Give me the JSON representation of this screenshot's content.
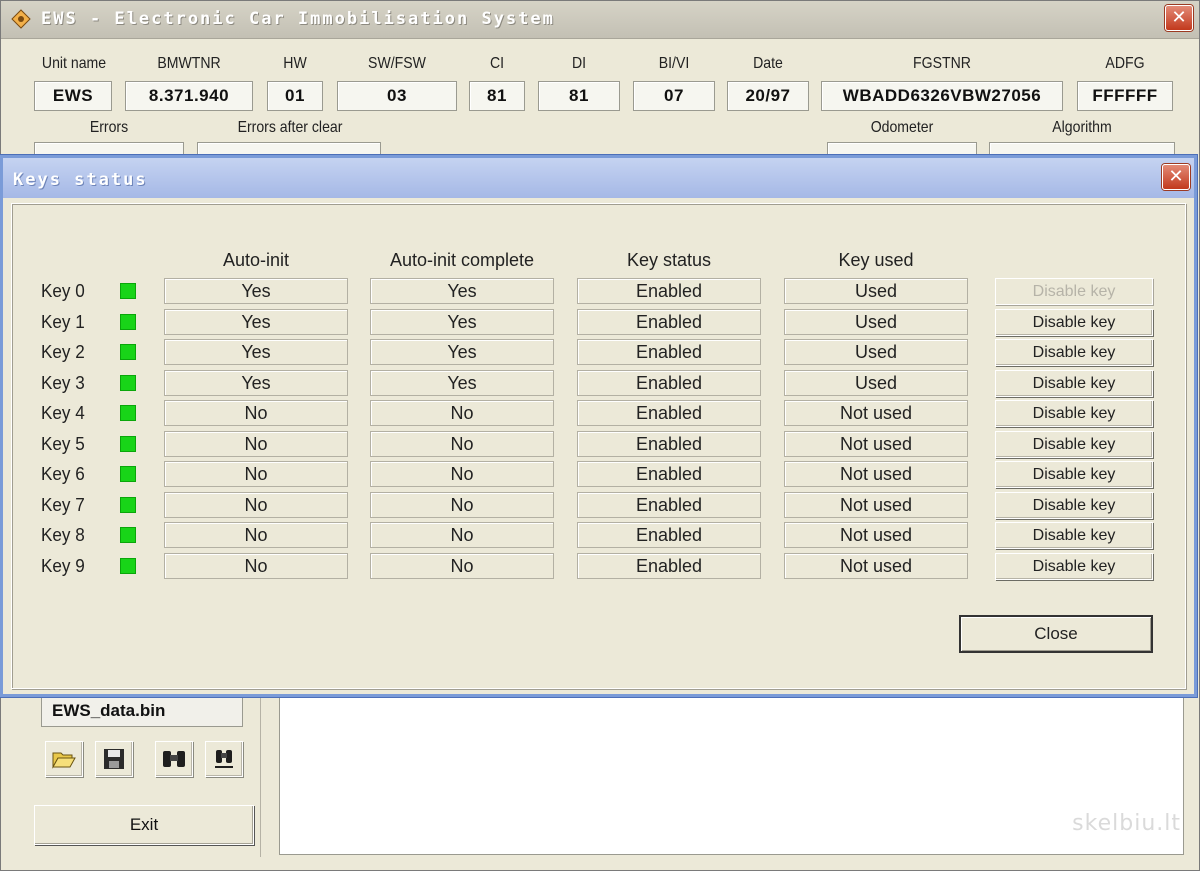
{
  "main_window": {
    "title": "EWS - Electronic Car Immobilisation System",
    "close_label": "✕"
  },
  "unit_info": {
    "labels": {
      "unit_name": "Unit name",
      "bmwtnr": "BMWTNR",
      "hw": "HW",
      "sw_fsw": "SW/FSW",
      "ci": "CI",
      "di": "DI",
      "bi_vi": "BI/VI",
      "date": "Date",
      "fgstnr": "FGSTNR",
      "adfg": "ADFG"
    },
    "values": {
      "unit_name": "EWS",
      "bmwtnr": "8.371.940",
      "hw": "01",
      "sw_fsw": "03",
      "ci": "81",
      "di": "81",
      "bi_vi": "07",
      "date": "20/97",
      "fgstnr": "WBADD6326VBW27056",
      "adfg": "FFFFFF"
    },
    "labels_row2": {
      "errors": "Errors",
      "errors_after_clear": "Errors after clear",
      "odometer": "Odometer",
      "algorithm": "Algorithm"
    }
  },
  "file": {
    "name": "EWS_data.bin"
  },
  "toolbar": {
    "open_icon": "folder-open-icon",
    "save_icon": "floppy-disk-icon",
    "find_icon": "binoculars-icon",
    "find_next_icon": "binoculars-small-icon"
  },
  "exit_label": "Exit",
  "watermark": "skelbiu.lt",
  "keys_dialog": {
    "title": "Keys status",
    "close_label": "✕",
    "headers": {
      "auto_init": "Auto-init",
      "auto_init_complete": "Auto-init complete",
      "key_status": "Key status",
      "key_used": "Key used"
    },
    "led_color": "#18d418",
    "rows": [
      {
        "label": "Key 0",
        "auto_init": "Yes",
        "auto_init_complete": "Yes",
        "status": "Enabled",
        "used": "Used",
        "button": "Disable key",
        "button_enabled": false
      },
      {
        "label": "Key 1",
        "auto_init": "Yes",
        "auto_init_complete": "Yes",
        "status": "Enabled",
        "used": "Used",
        "button": "Disable key",
        "button_enabled": true
      },
      {
        "label": "Key 2",
        "auto_init": "Yes",
        "auto_init_complete": "Yes",
        "status": "Enabled",
        "used": "Used",
        "button": "Disable key",
        "button_enabled": true
      },
      {
        "label": "Key 3",
        "auto_init": "Yes",
        "auto_init_complete": "Yes",
        "status": "Enabled",
        "used": "Used",
        "button": "Disable key",
        "button_enabled": true
      },
      {
        "label": "Key 4",
        "auto_init": "No",
        "auto_init_complete": "No",
        "status": "Enabled",
        "used": "Not used",
        "button": "Disable key",
        "button_enabled": true
      },
      {
        "label": "Key 5",
        "auto_init": "No",
        "auto_init_complete": "No",
        "status": "Enabled",
        "used": "Not used",
        "button": "Disable key",
        "button_enabled": true
      },
      {
        "label": "Key 6",
        "auto_init": "No",
        "auto_init_complete": "No",
        "status": "Enabled",
        "used": "Not used",
        "button": "Disable key",
        "button_enabled": true
      },
      {
        "label": "Key 7",
        "auto_init": "No",
        "auto_init_complete": "No",
        "status": "Enabled",
        "used": "Not used",
        "button": "Disable key",
        "button_enabled": true
      },
      {
        "label": "Key 8",
        "auto_init": "No",
        "auto_init_complete": "No",
        "status": "Enabled",
        "used": "Not used",
        "button": "Disable key",
        "button_enabled": true
      },
      {
        "label": "Key 9",
        "auto_init": "No",
        "auto_init_complete": "No",
        "status": "Enabled",
        "used": "Not used",
        "button": "Disable key",
        "button_enabled": true
      }
    ],
    "close_button": "Close"
  }
}
